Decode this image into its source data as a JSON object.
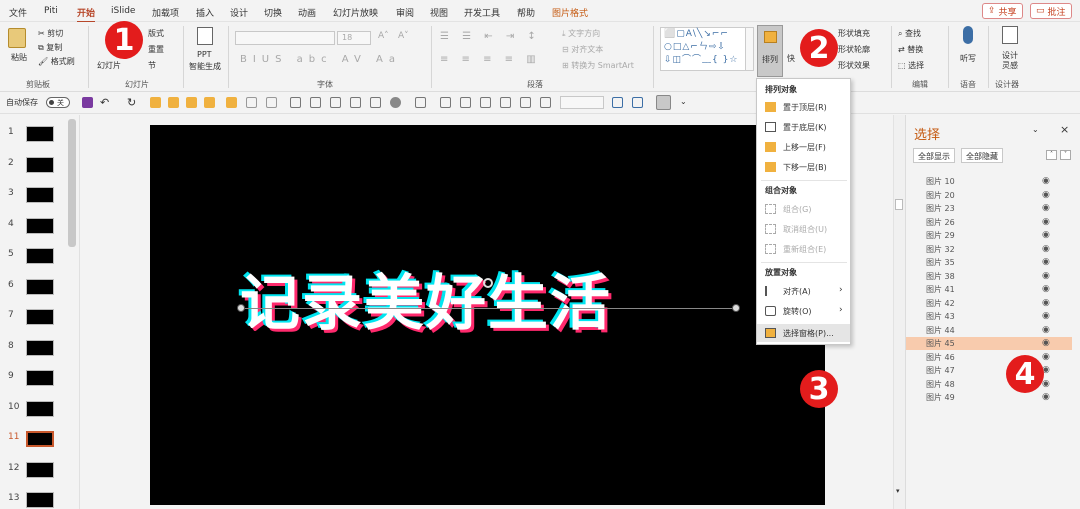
{
  "menu_tabs": [
    "文件",
    "Piti",
    "开始",
    "iSlide",
    "加载项",
    "插入",
    "设计",
    "切换",
    "动画",
    "幻灯片放映",
    "审阅",
    "视图",
    "开发工具",
    "帮助",
    "图片格式"
  ],
  "top_buttons": {
    "share": "共享",
    "comment": "批注"
  },
  "ribbon": {
    "clipboard": {
      "paste": "粘贴",
      "cut": "剪切",
      "copy": "复制",
      "format_painter": "格式刷",
      "label": "剪贴板"
    },
    "slides": {
      "new_slide": "幻灯片",
      "layout": "版式",
      "reset": "重置",
      "section": "节",
      "label": "幻灯片"
    },
    "ppt": {
      "line1": "PPT",
      "line2": "智能生成"
    },
    "font": {
      "label": "字体",
      "size": "18"
    },
    "paragraph": {
      "text_direction": "文字方向",
      "align_text": "对齐文本",
      "smartart": "转换为 SmartArt",
      "label": "段落"
    },
    "drawing": {
      "arrange": "排列",
      "quick": "快",
      "shape_fill": "形状填充",
      "shape_outline": "形状轮廓",
      "shape_effects": "形状效果"
    },
    "editing": {
      "find": "查找",
      "replace": "替换",
      "select": "选择",
      "label": "编辑"
    },
    "voice": {
      "dictate": "听写",
      "label": "语音"
    },
    "designer": {
      "line1": "设计",
      "line2": "灵感",
      "label": "设计器"
    }
  },
  "qat": {
    "autosave": "自动保存",
    "toggle": "关"
  },
  "slides": [
    {
      "num": "1"
    },
    {
      "num": "2"
    },
    {
      "num": "3"
    },
    {
      "num": "4"
    },
    {
      "num": "5"
    },
    {
      "num": "6"
    },
    {
      "num": "7"
    },
    {
      "num": "8"
    },
    {
      "num": "9"
    },
    {
      "num": "10"
    },
    {
      "num": "11"
    },
    {
      "num": "12"
    },
    {
      "num": "13"
    }
  ],
  "slide_text": "记录美好生活",
  "arrange_menu": {
    "h1": "排列对象",
    "items1": [
      "置于顶层(R)",
      "置于底层(K)",
      "上移一层(F)",
      "下移一层(B)"
    ],
    "h2": "组合对象",
    "items2": [
      "组合(G)",
      "取消组合(U)",
      "重新组合(E)"
    ],
    "h3": "放置对象",
    "items3": [
      "对齐(A)",
      "旋转(O)",
      "选择窗格(P)..."
    ]
  },
  "selection_pane": {
    "title": "选择",
    "show_all": "全部显示",
    "hide_all": "全部隐藏",
    "layers": [
      "图片 10",
      "图片 20",
      "图片 23",
      "图片 26",
      "图片 29",
      "图片 32",
      "图片 35",
      "图片 38",
      "图片 41",
      "图片 42",
      "图片 43",
      "图片 44",
      "图片 45",
      "图片 46",
      "图片 47",
      "图片 48",
      "图片 49"
    ],
    "selected": "图片 45"
  },
  "badges": [
    "1",
    "2",
    "3",
    "4"
  ],
  "colors": {
    "accent": "#b7472a",
    "badge": "#e31c1c",
    "selected_layer": "#f8cbad"
  }
}
